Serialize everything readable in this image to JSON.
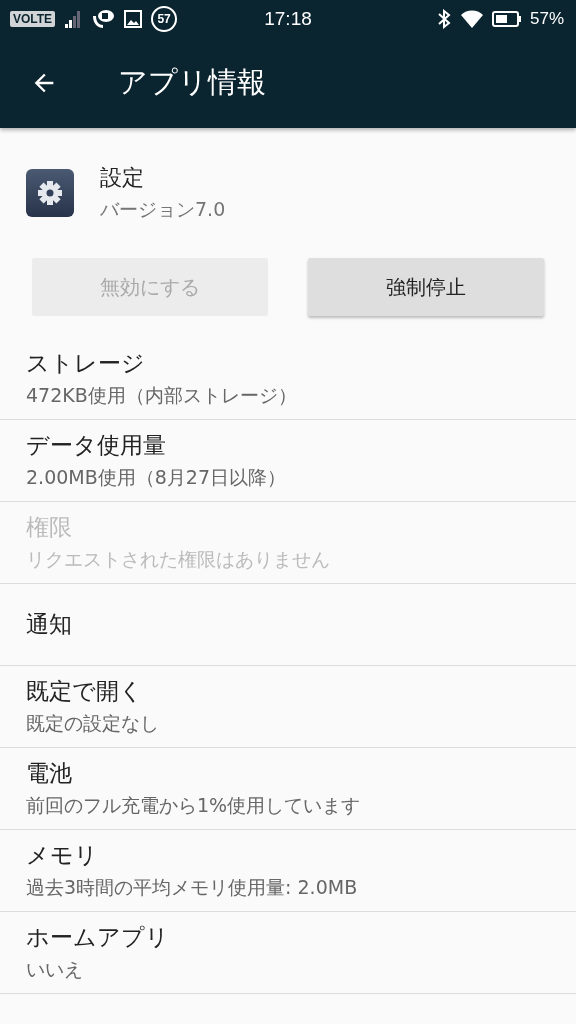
{
  "status_bar": {
    "network_badge": "VOLTE",
    "notification_count": "57",
    "time": "17:18",
    "battery_percent": "57%"
  },
  "toolbar": {
    "title": "アプリ情報"
  },
  "app": {
    "name": "設定",
    "version": "バージョン7.0"
  },
  "buttons": [
    {
      "label": "無効にする",
      "disabled": true
    },
    {
      "label": "強制停止",
      "disabled": false
    }
  ],
  "items": [
    {
      "title": "ストレージ",
      "subtitle": "472KB使用（内部ストレージ）",
      "disabled": false
    },
    {
      "title": "データ使用量",
      "subtitle": "2.00MB使用（8月27日以降）",
      "disabled": false
    },
    {
      "title": "権限",
      "subtitle": "リクエストされた権限はありません",
      "disabled": true
    },
    {
      "title": "通知",
      "disabled": false
    },
    {
      "title": "既定で開く",
      "subtitle": "既定の設定なし",
      "disabled": false
    },
    {
      "title": "電池",
      "subtitle": "前回のフル充電から1%使用しています",
      "disabled": false
    },
    {
      "title": "メモリ",
      "subtitle": "過去3時間の平均メモリ使用量: 2.0MB",
      "disabled": false
    },
    {
      "title": "ホームアプリ",
      "subtitle": "いいえ",
      "disabled": false
    }
  ]
}
